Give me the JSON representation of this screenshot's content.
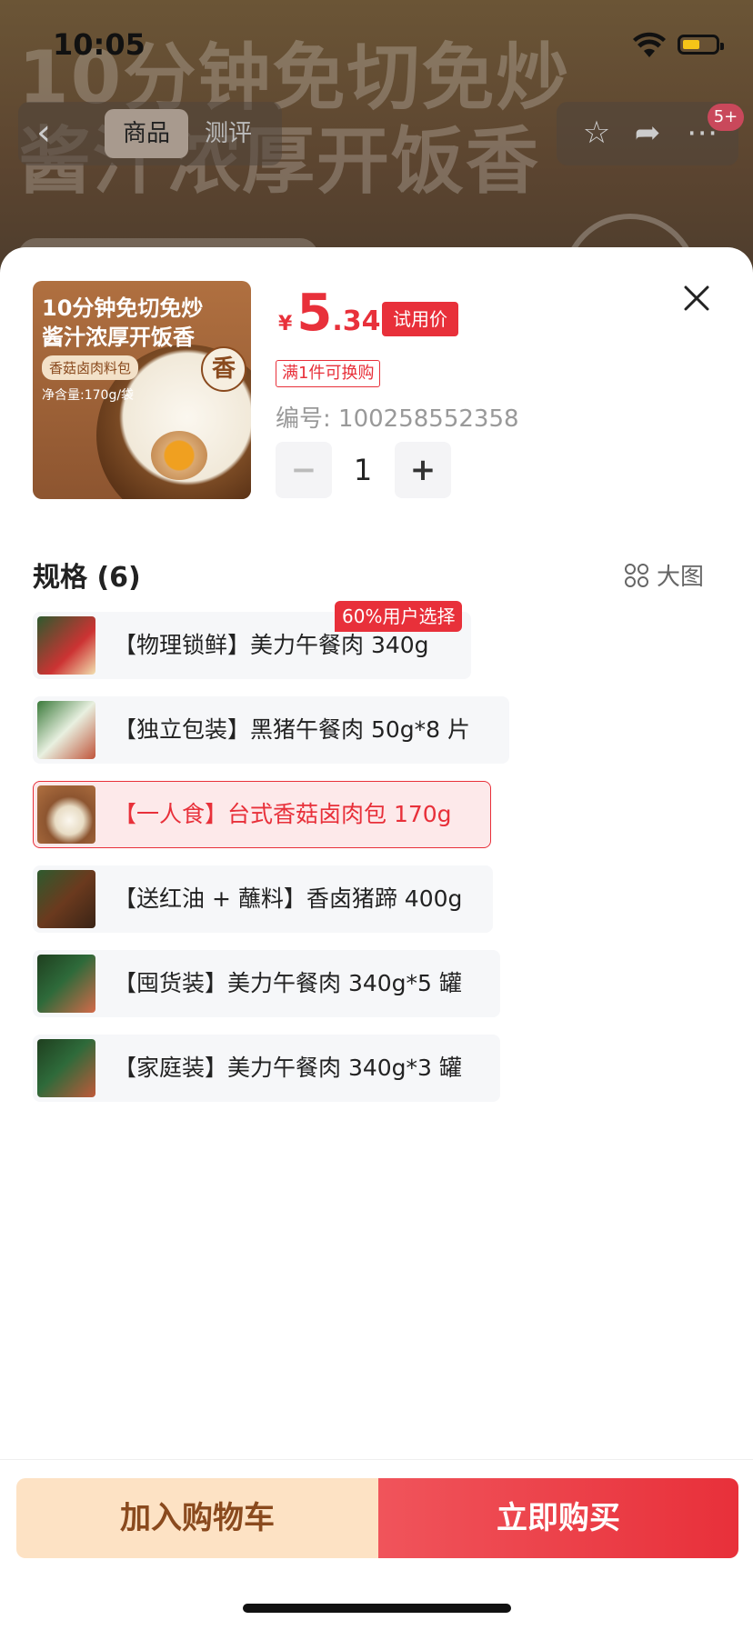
{
  "status": {
    "time": "10:05"
  },
  "background": {
    "hero_line1": "10分钟免切免炒",
    "hero_line2": "酱汁浓厚开饭香",
    "nav_tab_product": "商品",
    "nav_tab_review": "测评",
    "notification_badge": "5+"
  },
  "product": {
    "image_line1": "10分钟免切免炒",
    "image_line2": "酱汁浓厚开饭香",
    "image_tag": "香菇卤肉料包",
    "image_net": "净含量:170g/袋",
    "image_seal": "香",
    "price_symbol": "¥",
    "price_int": "5",
    "price_dec": ".34",
    "price_badge": "试用价",
    "promo": "满1件可换购",
    "sku_label": "编号: 100258552358",
    "quantity": "1",
    "minus": "−",
    "plus": "+"
  },
  "specs": {
    "title": "规格 (6)",
    "big_image": "大图",
    "top_badge": "60%用户选择",
    "options": [
      {
        "label": "【物理锁鲜】美力午餐肉 340g",
        "selected": false
      },
      {
        "label": "【独立包装】黑猪午餐肉 50g*8 片",
        "selected": false
      },
      {
        "label": "【一人食】台式香菇卤肉包 170g",
        "selected": true
      },
      {
        "label": "【送红油 + 蘸料】香卤猪蹄 400g",
        "selected": false
      },
      {
        "label": "【囤货装】美力午餐肉 340g*5 罐",
        "selected": false
      },
      {
        "label": "【家庭装】美力午餐肉 340g*3 罐",
        "selected": false
      }
    ]
  },
  "actions": {
    "add_to_cart": "加入购物车",
    "buy_now": "立即购买"
  },
  "colors": {
    "accent": "#e8303a",
    "cart_bg": "#fde2c4",
    "cart_text": "#8a4a1e"
  }
}
